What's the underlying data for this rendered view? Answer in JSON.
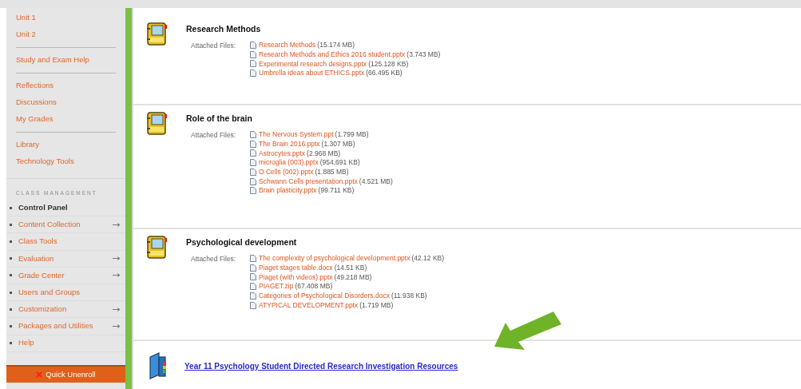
{
  "sidebar": {
    "groups": [
      [
        {
          "label": "Unit 1"
        },
        {
          "label": "Unit 2"
        }
      ],
      [
        {
          "label": "Study and Exam Help"
        }
      ],
      [
        {
          "label": "Reflections"
        },
        {
          "label": "Discussions"
        },
        {
          "label": "My Grades"
        }
      ],
      [
        {
          "label": "Library"
        },
        {
          "label": "Technology Tools"
        }
      ]
    ],
    "class_management": {
      "heading": "CLASS MANAGEMENT",
      "items": [
        {
          "label": "Control Panel",
          "kind": "header",
          "has_submenu": false
        },
        {
          "label": "Content Collection",
          "kind": "link",
          "has_submenu": true
        },
        {
          "label": "Class Tools",
          "kind": "link",
          "has_submenu": false
        },
        {
          "label": "Evaluation",
          "kind": "link",
          "has_submenu": true
        },
        {
          "label": "Grade Center",
          "kind": "link",
          "has_submenu": true
        },
        {
          "label": "Users and Groups",
          "kind": "link",
          "has_submenu": false
        },
        {
          "label": "Customization",
          "kind": "link",
          "has_submenu": true
        },
        {
          "label": "Packages and Utilities",
          "kind": "link",
          "has_submenu": true
        },
        {
          "label": "Help",
          "kind": "link",
          "has_submenu": false
        }
      ]
    },
    "unenroll_button": "Quick Unenroll"
  },
  "content": {
    "items": [
      {
        "title": "Research Methods",
        "files_label": "Attached Files:",
        "files": [
          {
            "name": "Research Methods",
            "size": "(15.174 MB)"
          },
          {
            "name": "Research Methods and Ethics 2016 student.pptx",
            "size": "(3.743 MB)"
          },
          {
            "name": "Experimental research designs.pptx",
            "size": "(125.128 KB)"
          },
          {
            "name": "Umbrella ideas about ETHICS.pptx",
            "size": "(66.495 KB)"
          }
        ]
      },
      {
        "title": "Role of the brain",
        "files_label": "Attached Files:",
        "files": [
          {
            "name": "The Nervous System.ppt",
            "size": "(1.799 MB)"
          },
          {
            "name": "The Brain 2016.pptx",
            "size": "(1.307 MB)"
          },
          {
            "name": "Astrocytes.pptx",
            "size": "(2.968 MB)"
          },
          {
            "name": "microglia (003).pptx",
            "size": "(954.691 KB)"
          },
          {
            "name": "O Cells (002).pptx",
            "size": "(1.885 MB)"
          },
          {
            "name": "Schwann Cells presentation.pptx",
            "size": "(4.521 MB)"
          },
          {
            "name": "Brain plasticity.pptx",
            "size": "(99.711 KB)"
          }
        ]
      },
      {
        "title": "Psychological development",
        "files_label": "Attached Files:",
        "files": [
          {
            "name": "The complexity of psychological development.pptx",
            "size": "(42.12 KB)"
          },
          {
            "name": "Piaget stages table.docx",
            "size": "(14.51 KB)"
          },
          {
            "name": "Piaget (with videos).pptx",
            "size": "(49.218 MB)"
          },
          {
            "name": "PIAGET.zip",
            "size": "(67.408 MB)"
          },
          {
            "name": "Categories of Psychological Disorders.docx",
            "size": "(11.938 KB)"
          },
          {
            "name": "ATYPICAL DEVELOPMENT.pptx",
            "size": "(1.719 MB)"
          }
        ]
      }
    ],
    "folder_link": "Year 11 Psychology Student Directed Research Investigation Resources"
  }
}
